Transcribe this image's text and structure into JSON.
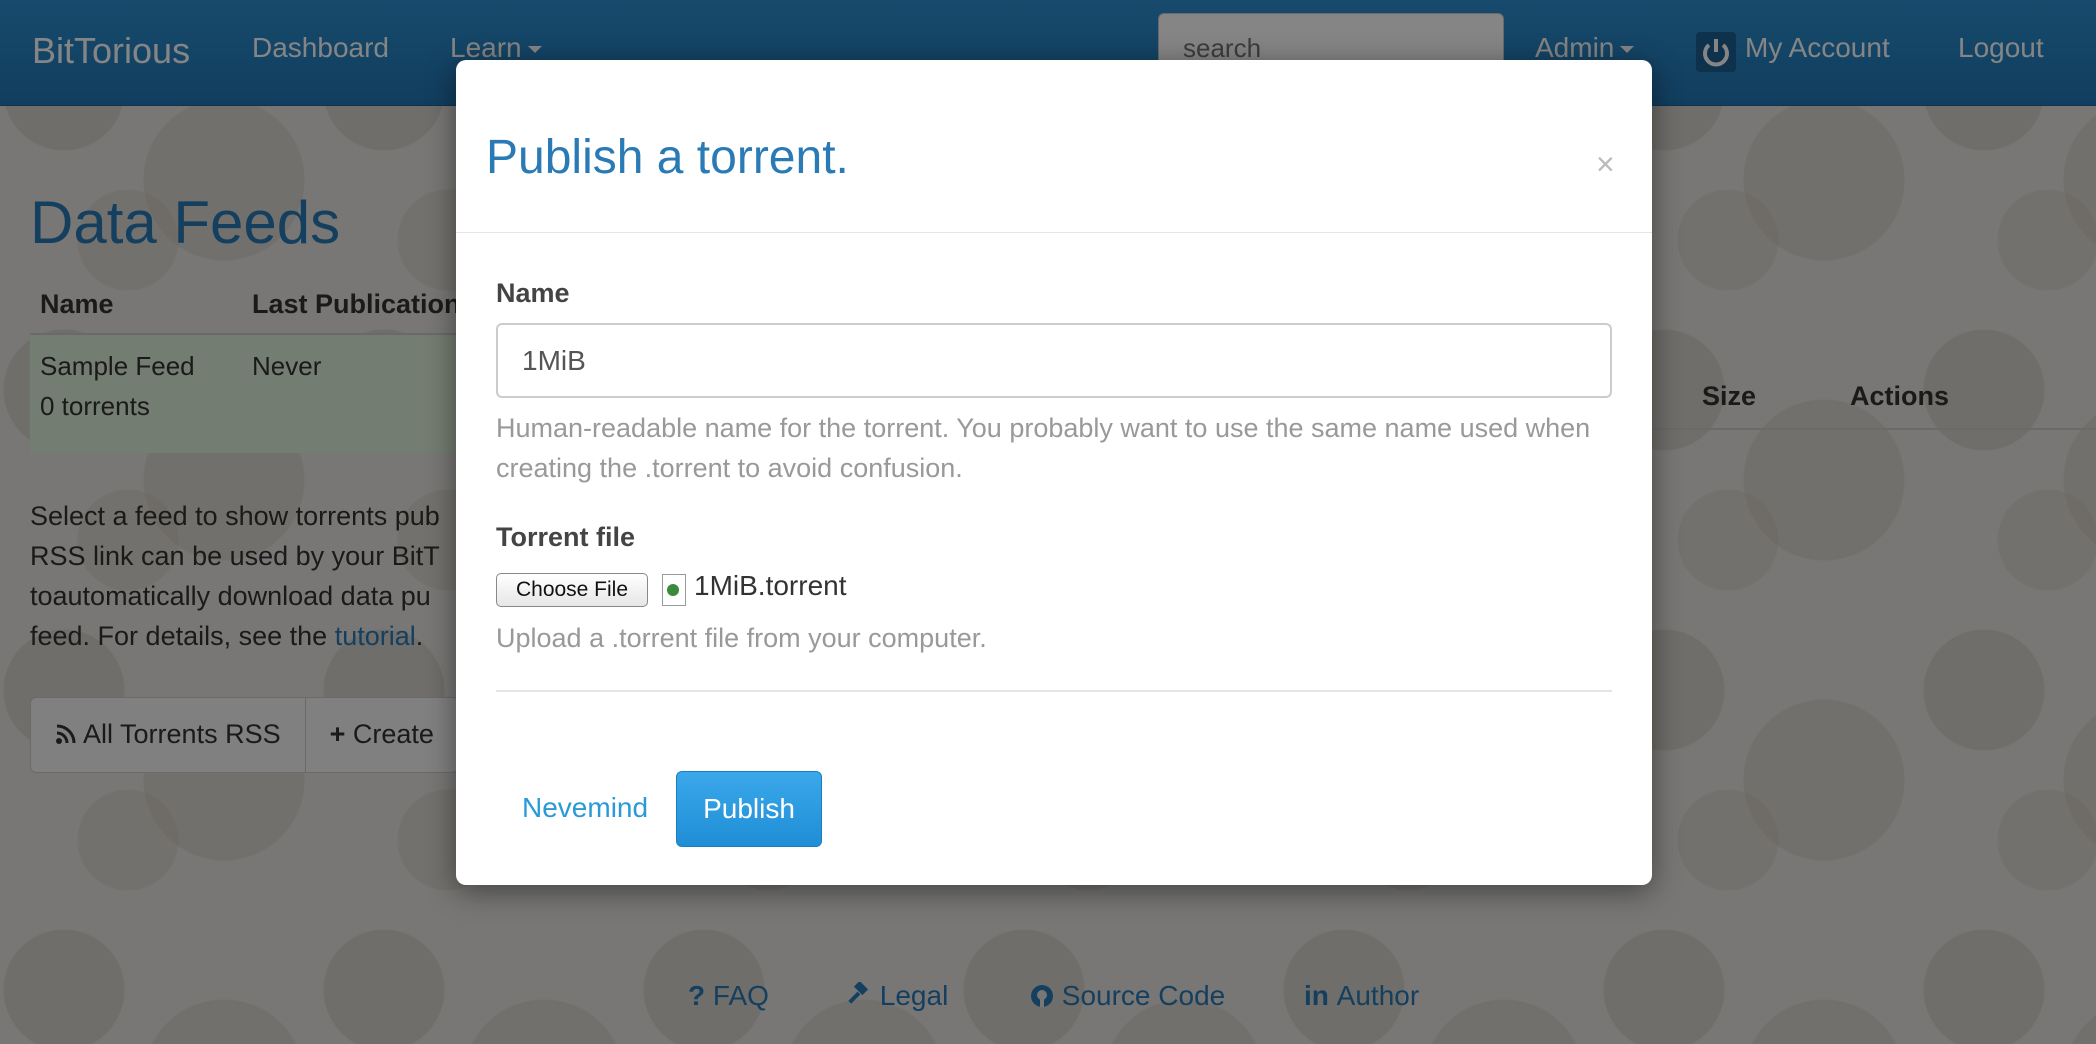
{
  "navbar": {
    "brand": "BitTorious",
    "dashboard": "Dashboard",
    "learn": "Learn",
    "search_placeholder": "search",
    "admin": "Admin",
    "my_account": "My Account",
    "logout": "Logout"
  },
  "page": {
    "title": "Data Feeds",
    "feeds_table": {
      "headers": [
        "Name",
        "Last Publication"
      ],
      "rows": [
        {
          "name": "Sample Feed",
          "sub": "0 torrents",
          "last": "Never"
        }
      ]
    },
    "torrents_table": {
      "headers": [
        "Size",
        "Actions"
      ]
    },
    "description": {
      "lines": [
        "Select a feed to show torrents pub",
        "RSS link can be used by your BitT",
        "toautomatically download data pu"
      ],
      "last_line_prefix": "feed. For details, see the ",
      "link": "tutorial",
      "suffix": "."
    },
    "buttons": {
      "all_torrents_rss": "All Torrents RSS",
      "create": "Create"
    }
  },
  "footer": {
    "faq": "FAQ",
    "legal": "Legal",
    "source": "Source Code",
    "author": "Author"
  },
  "modal": {
    "title": "Publish a torrent.",
    "close": "×",
    "name_label": "Name",
    "name_value": "1MiB",
    "name_help": "Human-readable name for the torrent. You probably want to use the same name used when creating the .torrent to avoid confusion.",
    "file_label": "Torrent file",
    "choose_file": "Choose File",
    "file_name": "1MiB.torrent",
    "file_help": "Upload a .torrent file from your computer.",
    "cancel": "Nevemind",
    "publish": "Publish"
  }
}
